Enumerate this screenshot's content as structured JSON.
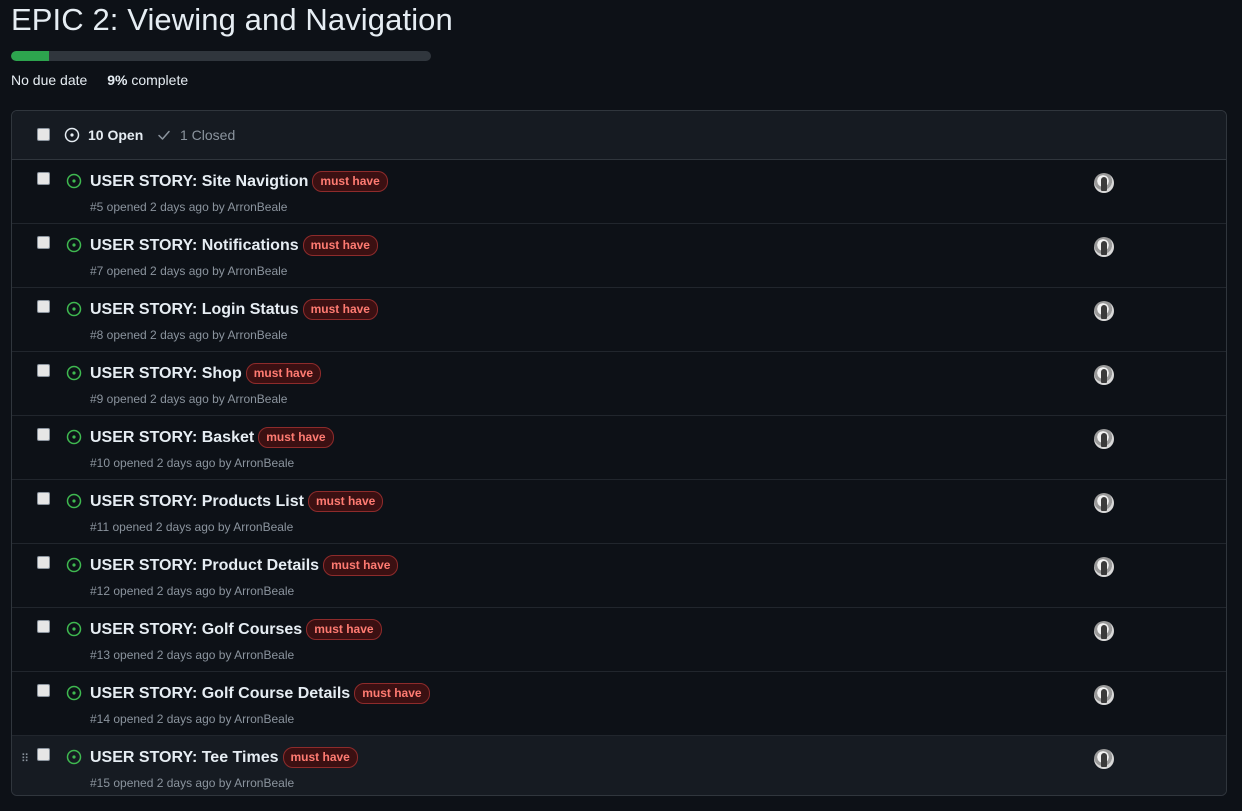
{
  "milestone": {
    "title": "EPIC 2: Viewing and Navigation",
    "progress_fraction": 0.09,
    "due_text": "No due date",
    "percent": "9%",
    "complete_label": "complete",
    "progress_color": "#2da44e"
  },
  "header": {
    "open_label": "10 Open",
    "closed_label": "1 Closed"
  },
  "issues": [
    {
      "title": "USER STORY: Site Navigtion",
      "label": "must have",
      "meta": "#5 opened 2 days ago by ArronBeale"
    },
    {
      "title": "USER STORY: Notifications",
      "label": "must have",
      "meta": "#7 opened 2 days ago by ArronBeale"
    },
    {
      "title": "USER STORY: Login Status",
      "label": "must have",
      "meta": "#8 opened 2 days ago by ArronBeale"
    },
    {
      "title": "USER STORY: Shop",
      "label": "must have",
      "meta": "#9 opened 2 days ago by ArronBeale"
    },
    {
      "title": "USER STORY: Basket",
      "label": "must have",
      "meta": "#10 opened 2 days ago by ArronBeale"
    },
    {
      "title": "USER STORY: Products List",
      "label": "must have",
      "meta": "#11 opened 2 days ago by ArronBeale"
    },
    {
      "title": "USER STORY: Product Details",
      "label": "must have",
      "meta": "#12 opened 2 days ago by ArronBeale"
    },
    {
      "title": "USER STORY: Golf Courses",
      "label": "must have",
      "meta": "#13 opened 2 days ago by ArronBeale"
    },
    {
      "title": "USER STORY: Golf Course Details",
      "label": "must have",
      "meta": "#14 opened 2 days ago by ArronBeale"
    },
    {
      "title": "USER STORY: Tee Times",
      "label": "must have",
      "meta": "#15 opened 2 days ago by ArronBeale"
    }
  ],
  "colors": {
    "background": "#0d1117",
    "open_icon": "#3fb950",
    "label_text": "#ff7b72",
    "label_bg": "#3b1012"
  }
}
